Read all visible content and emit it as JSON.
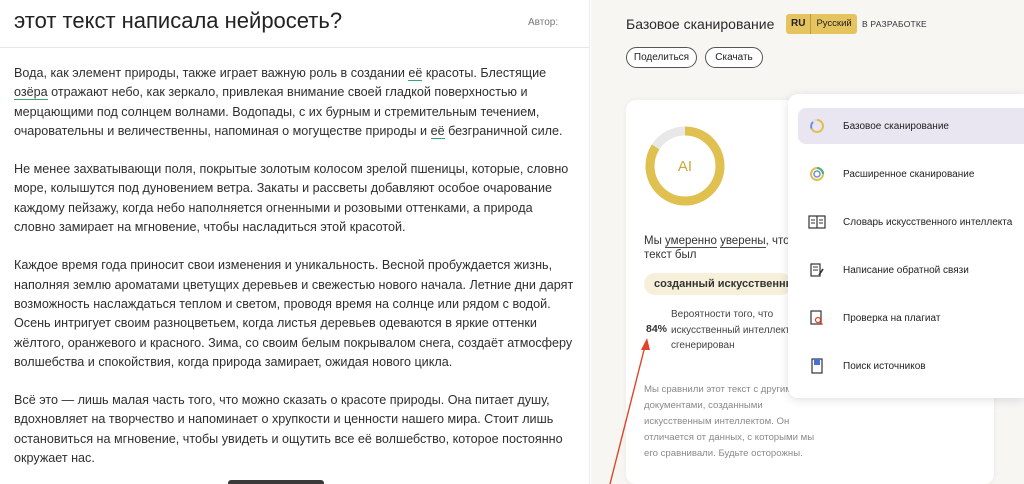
{
  "document": {
    "title": "этот текст написала нейросеть?",
    "author_label": "Автор:",
    "paragraphs": [
      [
        [
          "Вода, как элемент природы, также играет важную роль в создании ",
          {
            "u": "её"
          },
          " красоты. Блестящие"
        ],
        [
          {
            "u": "озёра"
          },
          " отражают небо, как зеркало, привлекая внимание своей гладкой поверхностью и"
        ],
        [
          "мерцающими под солнцем волнами. Водопады, с их бурным и стремительным течением,"
        ],
        [
          "очаровательны и величественны, напоминая о могуществе природы и ",
          {
            "u": "её"
          },
          " безграничной силе."
        ]
      ],
      [
        [
          "Не менее захватывающи поля, покрытые золотым колосом зрелой пшеницы, которые, словно"
        ],
        [
          "море, колышутся под дуновением ветра. Закаты и рассветы добавляют особое очарование"
        ],
        [
          "каждому пейзажу, когда небо наполняется огненными и розовыми оттенками, а природа"
        ],
        [
          "словно замирает на мгновение, чтобы насладиться этой красотой."
        ]
      ],
      [
        [
          "Каждое время года приносит свои изменения и уникальность. Весной пробуждается жизнь,"
        ],
        [
          "наполняя землю ароматами цветущих деревьев и свежестью нового начала. Летние дни дарят"
        ],
        [
          "возможность наслаждаться теплом и светом, проводя время на солнце или рядом с водой."
        ],
        [
          "Осень интригует своим разноцветьем, когда листья деревьев одеваются в яркие оттенки"
        ],
        [
          "жёлтого, оранжевого и красного. Зима, со своим белым покрывалом снега, создаёт атмосферу"
        ],
        [
          "волшебства и спокойствия, когда природа замирает, ожидая нового цикла."
        ]
      ],
      [
        [
          "Всё это — лишь малая часть того, что можно сказать о красоте природы. Она питает душу,"
        ],
        [
          "вдохновляет на творчество и напоминает о хрупкости и ценности нашего мира. Стоит лишь"
        ],
        [
          "остановиться на мгновение, чтобы увидеть и ощутить все её волшебство, которое постоянно"
        ],
        [
          "окружает нас."
        ]
      ]
    ]
  },
  "scan": {
    "title": "Базовое сканирование",
    "lang_code": "RU",
    "lang_name": "Русский",
    "status": "В РАЗРАБОТКЕ",
    "share_label": "Поделиться",
    "download_label": "Скачать",
    "donut_label": "AI",
    "ai_fraction": 0.84,
    "verdict_prefix": "Мы ",
    "verdict_word1": "умеренно",
    "verdict_word2": "уверены",
    "verdict_suffix": ", что",
    "verdict_line2": "текст был",
    "verdict_pill": "созданный искусственным",
    "probability_value": "84%",
    "probability_lines": [
      "Вероятности того, что",
      "искусственный интеллект",
      "сгенерирован"
    ],
    "note_lines": [
      "Мы сравнили этот текст с другими",
      "документами, созданными",
      "искусственным интеллектом. Он",
      "отличается от данных, с которыми мы",
      "его сравнивали. Будьте осторожны."
    ]
  },
  "menu": {
    "items": [
      {
        "label": "Базовое сканирование",
        "icon": "basic-scan-icon",
        "active": true
      },
      {
        "label": "Расширенное сканирование",
        "icon": "advanced-scan-icon",
        "active": false
      },
      {
        "label": "Словарь искусственного интеллекта",
        "icon": "dictionary-icon",
        "active": false
      },
      {
        "label": "Написание обратной связи",
        "icon": "feedback-icon",
        "active": false
      },
      {
        "label": "Проверка на плагиат",
        "icon": "plagiarism-icon",
        "active": false
      },
      {
        "label": "Поиск источников",
        "icon": "sources-icon",
        "active": false
      }
    ]
  },
  "colors": {
    "accent_gold": "#e0c04e",
    "donut_track": "#e8e8e8",
    "underline_green": "#3aa76d",
    "menu_active_bg": "#e9e6f1",
    "annotation_arrow": "#e0452b"
  }
}
